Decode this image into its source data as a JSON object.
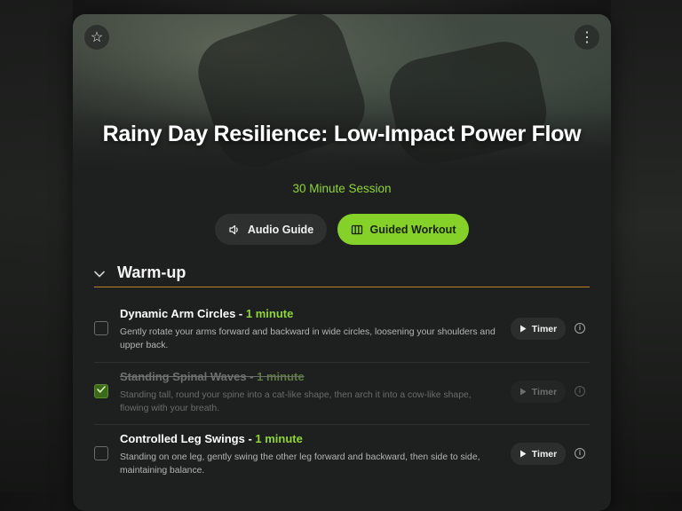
{
  "workout": {
    "title": "Rainy Day Resilience: Low-Impact Power Flow",
    "session": "30 Minute Session",
    "favorite_icon": "star-icon",
    "menu_icon": "more-vertical-icon"
  },
  "actions": {
    "audio_label": "Audio Guide",
    "audio_icon": "speaker-icon",
    "guided_label": "Guided Workout",
    "guided_icon": "columns-icon"
  },
  "section": {
    "title": "Warm-up",
    "expanded": true
  },
  "exercises": [
    {
      "name": "Dynamic Arm Circles",
      "separator": " - ",
      "duration": "1 minute",
      "description": "Gently rotate your arms forward and backward in wide circles, loosening your shoulders and upper back.",
      "completed": false,
      "timer_label": "Timer"
    },
    {
      "name": "Standing Spinal Waves",
      "separator": " - ",
      "duration": "1 minute",
      "description": "Standing tall, round your spine into a cat-like shape, then arch it into a cow-like shape, flowing with your breath.",
      "completed": true,
      "timer_label": "Timer"
    },
    {
      "name": "Controlled Leg Swings",
      "separator": " - ",
      "duration": "1 minute",
      "description": "Standing on one leg, gently swing the other leg forward and backward, then side to side, maintaining balance.",
      "completed": false,
      "timer_label": "Timer"
    }
  ],
  "colors": {
    "accent": "#86d02a",
    "section_rule": "#b98528",
    "card": "#1e1f1f"
  }
}
